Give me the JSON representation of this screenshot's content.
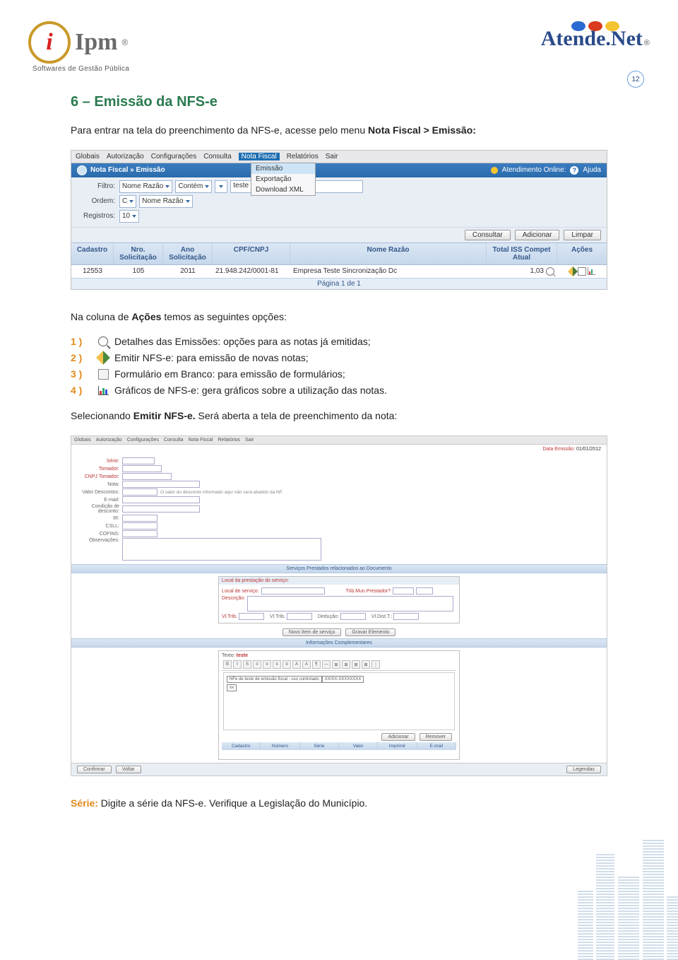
{
  "page_number": "12",
  "logos": {
    "ipm_letter": "i",
    "ipm_name": "Ipm",
    "ipm_reg": "®",
    "ipm_subtitle": "Softwares de Gestão Pública",
    "atende_text": "Atende.Net",
    "atende_reg": "®"
  },
  "section_title": "6 – Emissão da NFS-e",
  "intro_text_1": "Para entrar na tela do preenchimento da NFS-e, acesse pelo menu ",
  "intro_bold_1": "Nota Fiscal > Emissão:",
  "ss1": {
    "menu": [
      "Globais",
      "Autorização",
      "Configurações",
      "Consulta",
      "Nota Fiscal",
      "Relatórios",
      "Sair"
    ],
    "submenu": [
      "Emissão",
      "Exportação",
      "Download XML"
    ],
    "breadcrumb": "Nota Fiscal » Emissão",
    "right_online": "Atendimento Online:",
    "right_help": "Ajuda",
    "help_q": "?",
    "filters": {
      "filtro_label": "Filtro:",
      "filtro_field": "Nome Razão",
      "filtro_op": "Contém",
      "filtro_value": "teste",
      "ordem_label": "Ordem:",
      "ordem_dir": "C",
      "ordem_field": "Nome Razão",
      "registros_label": "Registros:",
      "registros_val": "10"
    },
    "buttons": {
      "consultar": "Consultar",
      "adicionar": "Adicionar",
      "limpar": "Limpar"
    },
    "columns": {
      "cadastro": "Cadastro",
      "nro": "Nro. Solicitação",
      "ano": "Ano Solicitação",
      "cpf": "CPF/CNPJ",
      "nome": "Nome Razão",
      "total": "Total ISS Compet Atual",
      "acoes": "Ações"
    },
    "row": {
      "cadastro": "12553",
      "nro": "105",
      "ano": "2011",
      "cpf": "21.948.242/0001-81",
      "nome": "Empresa Teste Sincronização Dc",
      "total": "1,03"
    },
    "pager": "Página 1 de 1"
  },
  "options_intro_1": "Na coluna de ",
  "options_intro_bold": "Ações",
  "options_intro_2": " temos as seguintes opções:",
  "options": [
    {
      "num": "1 )",
      "text": "Detalhes das Emissões: opções para as notas já emitidas;"
    },
    {
      "num": "2 )",
      "text": "Emitir NFS-e: para emissão de novas notas;"
    },
    {
      "num": "3 )",
      "text": "Formulário em Branco: para emissão de formulários;"
    },
    {
      "num": "4 )",
      "text": "Gráficos de NFS-e: gera gráficos sobre a utilização das notas."
    }
  ],
  "select_text_1": "Selecionando ",
  "select_bold": "Emitir NFS-e.",
  "select_text_2": " Será aberta a tela de preenchimento da nota:",
  "ss2": {
    "menu": [
      "Globais",
      "Autorização",
      "Configurações",
      "Consulta",
      "Nota Fiscal",
      "Relatórios",
      "Sair"
    ],
    "date_label": "Data Emissão:",
    "date_value": "01/01/2012",
    "labels": {
      "serie": "Série:",
      "tomador": "Tomador:",
      "cnpj_tomador": "CNPJ Tomador:",
      "nota": "Nota:",
      "valor_desconto": "Valor Descontos:",
      "desconto_hint": "O valor do desconto informado aqui não será abatido da NF.",
      "email": "E-mail:",
      "cond_desconto": "Condição de desconto:",
      "ir": "IR:",
      "csll": "CSLL:",
      "cofins": "COFINS:",
      "observacoes": "Observações:"
    },
    "section_servicos": "Serviços Prestados relacionados ao Documento",
    "locais_label": "Local da prestação do serviço:",
    "local_servico": "Local de serviço:",
    "trib_mun": "Trib.Mun.Prestador?",
    "descricao": "Descrição:",
    "vl_trib": "Vl.Trib.",
    "vl_ret": "Vl.Trib.",
    "deducao": "Dedução:",
    "vl_dist_t": "Vl.Dist.T.:",
    "btn_novo": "Novo Item de serviço",
    "btn_gravar": "Gravar Elemento",
    "section_info": "Informações Complementares",
    "texto_label": "Texto:",
    "rich_buttons": [
      "B",
      "I",
      "S",
      "≡",
      "≡",
      "≡",
      "≡",
      "A",
      "A",
      "¶",
      "—",
      "⊞",
      "⊞",
      "⊞",
      "⊞",
      "⋮"
    ],
    "rich_cell1": "NFe de teste de emissão fiscal - uso controlado",
    "rich_cell2": "XX/XX-XXXXXXXX",
    "rich_cell3": "xx",
    "btn_adicionar": "Adicionar",
    "btn_remover": "Remover",
    "cols2": [
      "Cadastro",
      "Número",
      "Série",
      "Valor",
      "Imprimir",
      "E-mail"
    ],
    "btn_confirmar": "Confirmar",
    "btn_voltar": "Voltar",
    "btn_legendas": "Legendas"
  },
  "foot_lead": "Série:",
  "foot_text": " Digite a série da NFS-e. Verifique a Legislação do Município."
}
